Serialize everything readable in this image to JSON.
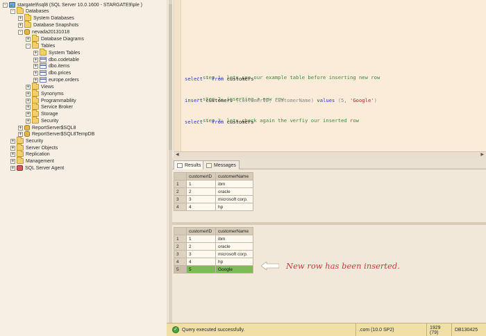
{
  "explorer": {
    "items": [
      {
        "label": "stargate9\\sql8 (SQL Server 10.0.1600 - STARGATE9\\ple    )",
        "icon": "server-icon",
        "expander": "-"
      },
      {
        "label": "Databases",
        "icon": "folder-icon",
        "expander": "-"
      },
      {
        "label": "System Databases",
        "icon": "folder-icon",
        "expander": "+"
      },
      {
        "label": "Database Snapshots",
        "icon": "folder-icon",
        "expander": "+"
      },
      {
        "label": "nevada20131018",
        "icon": "database-icon",
        "expander": "-"
      },
      {
        "label": "Database Diagrams",
        "icon": "folder-icon",
        "expander": "+"
      },
      {
        "label": "Tables",
        "icon": "folder-icon",
        "expander": "-"
      },
      {
        "label": "System Tables",
        "icon": "folder-icon",
        "expander": "+"
      },
      {
        "label": "dbo.codetable",
        "icon": "table-icon",
        "expander": "+"
      },
      {
        "label": "dbo.items",
        "icon": "table-icon",
        "expander": "+"
      },
      {
        "label": "dbo.prices",
        "icon": "table-icon",
        "expander": "+"
      },
      {
        "label": "europe.orders",
        "icon": "table-icon",
        "expander": "+"
      },
      {
        "label": "Views",
        "icon": "folder-icon",
        "expander": "+"
      },
      {
        "label": "Synonyms",
        "icon": "folder-icon",
        "expander": "+"
      },
      {
        "label": "Programmability",
        "icon": "folder-icon",
        "expander": "+"
      },
      {
        "label": "Service Broker",
        "icon": "folder-icon",
        "expander": "+"
      },
      {
        "label": "Storage",
        "icon": "folder-icon",
        "expander": "+"
      },
      {
        "label": "Security",
        "icon": "folder-icon",
        "expander": "+"
      },
      {
        "label": "ReportServer$SQL8",
        "icon": "database-icon",
        "expander": "+"
      },
      {
        "label": "ReportServer$SQL8TempDB",
        "icon": "database-icon",
        "expander": "+"
      },
      {
        "label": "Security",
        "icon": "folder-icon",
        "expander": "+"
      },
      {
        "label": "Server Objects",
        "icon": "folder-icon",
        "expander": "+"
      },
      {
        "label": "Replication",
        "icon": "folder-icon",
        "expander": "+"
      },
      {
        "label": "Management",
        "icon": "folder-icon",
        "expander": "+"
      },
      {
        "label": "SQL Server Agent",
        "icon": "agent-icon",
        "expander": "+"
      }
    ]
  },
  "editor": {
    "lines": {
      "step1_comment": "--step 1: lets see our example table before inserting new row",
      "step1_select": "select",
      "step1_star": " * ",
      "step1_from": "from",
      "step1_table": " customers",
      "step2_comment": "--step 2: inserting a new row",
      "step2_insert": "insert",
      "step2_table": " customers ",
      "step2_cols": "(customerID, customerName)",
      "step2_values": " values ",
      "step2_open": "(5, ",
      "step2_str": "'Google'",
      "step2_close": ")",
      "step3_comment": "--step 3: lets check again the verfiy our inserted row",
      "step3_select": "select",
      "step3_star": " * ",
      "step3_from": "from",
      "step3_table": " customers"
    }
  },
  "tabs": {
    "results": "Results",
    "messages": "Messages"
  },
  "grid1": {
    "columns": [
      "customerID",
      "customerName"
    ],
    "rows": [
      {
        "n": "1",
        "id": "1",
        "name": "ibm"
      },
      {
        "n": "2",
        "id": "2",
        "name": "oracle"
      },
      {
        "n": "3",
        "id": "3",
        "name": "microsoft corp."
      },
      {
        "n": "4",
        "id": "4",
        "name": "hp"
      }
    ]
  },
  "grid2": {
    "columns": [
      "customerID",
      "customerName"
    ],
    "rows": [
      {
        "n": "1",
        "id": "1",
        "name": "ibm"
      },
      {
        "n": "2",
        "id": "2",
        "name": "oracle"
      },
      {
        "n": "3",
        "id": "3",
        "name": "microsoft corp."
      },
      {
        "n": "4",
        "id": "4",
        "name": "hp"
      },
      {
        "n": "5",
        "id": "5",
        "name": "Google"
      }
    ]
  },
  "annotation": {
    "text": "New row has been inserted."
  },
  "status": {
    "message": "Query executed successfully.",
    "server": ".com (10.0 SP2)",
    "user": "1929 (79)",
    "database": "DB130425"
  },
  "colors": {
    "highlight_row": "#7dbb57",
    "annotation_text": "#c83d3d",
    "comment": "#3d8a3d",
    "keyword": "#2d39c5",
    "string": "#b02a2a"
  }
}
